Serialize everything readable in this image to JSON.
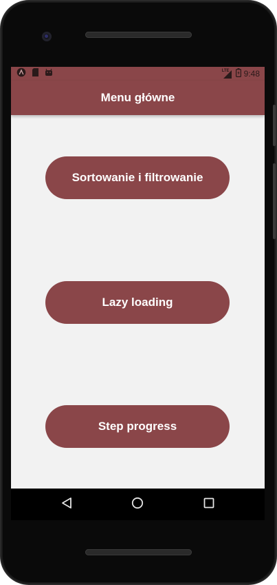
{
  "status_bar": {
    "network": "LTE",
    "time": "9:48"
  },
  "app_bar": {
    "title": "Menu główne"
  },
  "menu": {
    "buttons": [
      {
        "label": "Sortowanie i filtrowanie"
      },
      {
        "label": "Lazy loading"
      },
      {
        "label": "Step progress"
      }
    ]
  },
  "theme": {
    "primary": "#8a4649",
    "background": "#f2f2f2",
    "on_primary": "#ffffff"
  },
  "icons": {
    "status_left": [
      "notification-a-icon",
      "sd-card-icon",
      "android-icon"
    ],
    "status_right": [
      "lte-signal-icon",
      "battery-icon"
    ],
    "navigation": [
      "back-icon",
      "home-icon",
      "recents-icon"
    ]
  }
}
